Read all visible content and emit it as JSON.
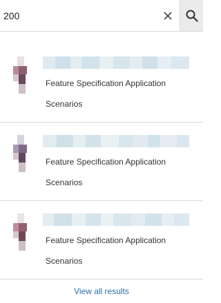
{
  "search": {
    "value": "200",
    "placeholder": "",
    "clear_icon": "close-icon",
    "search_icon": "search-icon"
  },
  "results": [
    {
      "line1": "Feature Specification Application",
      "line2": "Scenarios"
    },
    {
      "line1": "Feature Specification Application",
      "line2": "Scenarios"
    },
    {
      "line1": "Feature Specification Application",
      "line2": "Scenarios"
    }
  ],
  "footer": {
    "view_all_label": "View all results"
  },
  "colors": {
    "link": "#2a6fa8",
    "divider": "#d8d8d8",
    "search_button_bg": "#ebebeb"
  }
}
